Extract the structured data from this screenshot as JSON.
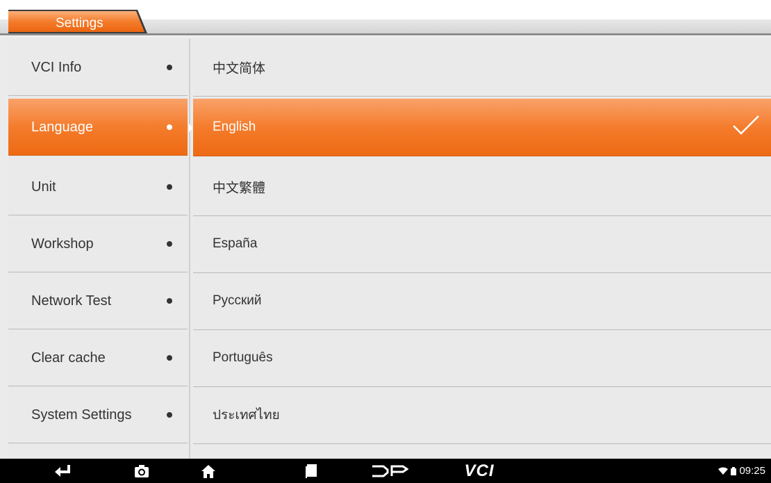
{
  "header": {
    "tab_title": "Settings"
  },
  "sidebar": {
    "items": [
      {
        "label": "VCI Info",
        "active": false
      },
      {
        "label": "Language",
        "active": true
      },
      {
        "label": "Unit",
        "active": false
      },
      {
        "label": "Workshop",
        "active": false
      },
      {
        "label": "Network Test",
        "active": false
      },
      {
        "label": "Clear cache",
        "active": false
      },
      {
        "label": "System Settings",
        "active": false
      }
    ]
  },
  "languages": {
    "items": [
      {
        "label": "中文简体",
        "selected": false
      },
      {
        "label": "English",
        "selected": true
      },
      {
        "label": "中文繁體",
        "selected": false
      },
      {
        "label": "España",
        "selected": false
      },
      {
        "label": "Русский",
        "selected": false
      },
      {
        "label": "Português",
        "selected": false
      },
      {
        "label": "ประเทศไทย",
        "selected": false
      }
    ]
  },
  "navbar": {
    "icons": [
      "back-icon",
      "camera-icon",
      "home-icon",
      "recent-apps-icon",
      "dp-logo-icon",
      "vci-icon"
    ],
    "vci_label": "VCI",
    "time": "09:25"
  },
  "colors": {
    "accent": "#f47c2c",
    "background": "#eaeaea",
    "navbar": "#000000"
  }
}
